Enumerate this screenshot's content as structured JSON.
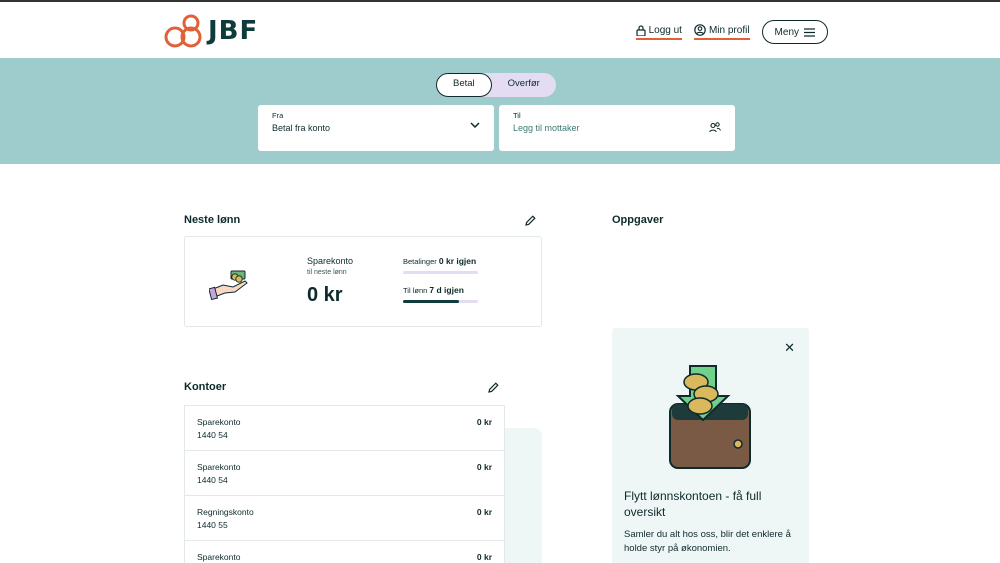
{
  "header": {
    "logo_text": "JBF",
    "logout": "Logg ut",
    "profile": "Min profil",
    "menu": "Meny"
  },
  "hero": {
    "tabs": [
      "Betal",
      "Overfør"
    ],
    "active_tab": "Betal",
    "from": {
      "label": "Fra",
      "value": "Betal fra konto"
    },
    "to": {
      "label": "Til",
      "placeholder": "Legg til mottaker"
    }
  },
  "salary": {
    "title": "Neste lønn",
    "account": "Sparekonto",
    "subtitle": "til neste lønn",
    "amount": "0 kr",
    "payments_label": "Betalinger",
    "payments_value": "0 kr igjen",
    "payments_progress": 0,
    "payday_label": "Til lønn",
    "payday_value": "7 d igjen",
    "payday_progress": 0.75
  },
  "accounts": {
    "title": "Kontoer",
    "items": [
      {
        "name": "Sparekonto",
        "number": "1440 54",
        "balance": "0 kr"
      },
      {
        "name": "Sparekonto",
        "number": "1440 54",
        "balance": "0 kr"
      },
      {
        "name": "Regningskonto",
        "number": "1440 55",
        "balance": "0 kr"
      },
      {
        "name": "Sparekonto",
        "number": "",
        "balance": "0 kr"
      }
    ]
  },
  "tasks": {
    "title": "Oppgaver",
    "card_title": "Flytt lønnskontoen - få full oversikt",
    "card_text": "Samler du alt hos oss, blir det enklere å holde styr på økonomien."
  },
  "colors": {
    "brand_orange": "#e0603a",
    "hero_bg": "#9ecbcc",
    "dark_green": "#0f3b3c",
    "lavender": "#e4dcf3"
  }
}
